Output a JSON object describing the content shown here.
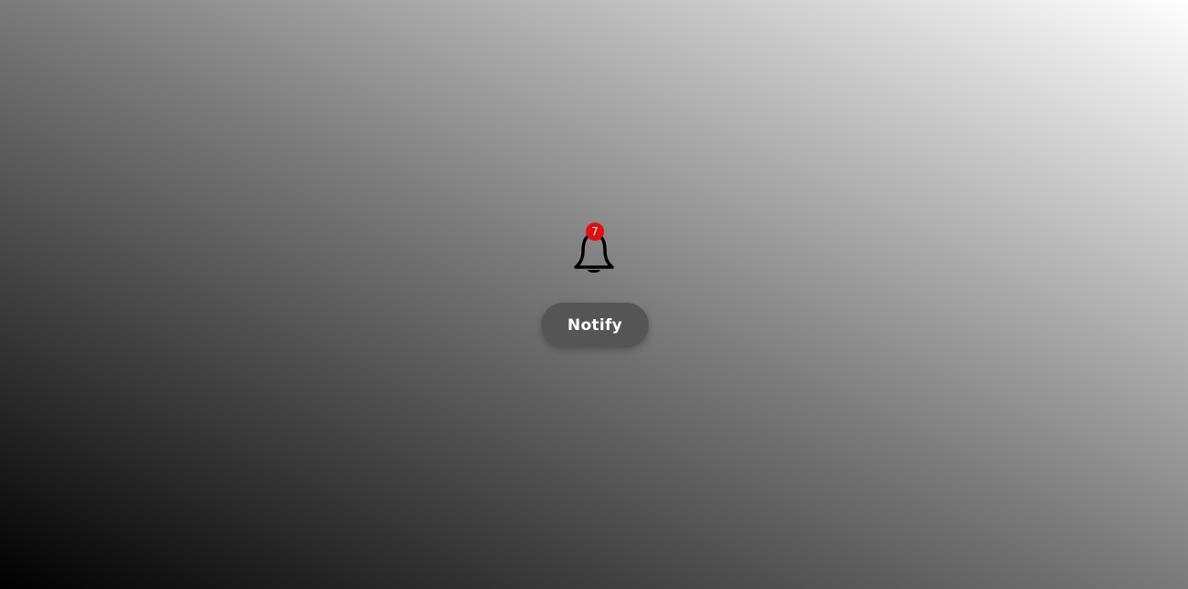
{
  "notification": {
    "count": "7",
    "badge_color": "#e01010",
    "icon": "bell-icon"
  },
  "button": {
    "label": "Notify",
    "background": "#555555"
  },
  "background": {
    "from": "#000000",
    "to": "#ffffff"
  }
}
